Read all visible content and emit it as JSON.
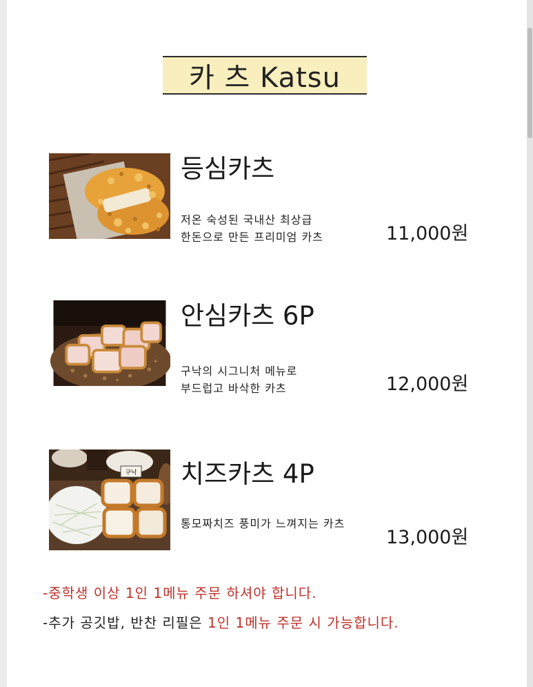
{
  "title": "카 츠 Katsu",
  "colors": {
    "title_background": "#f9efbe",
    "notice_red": "#c0302a",
    "text": "#222222"
  },
  "items": [
    {
      "name": "등심카츠",
      "desc": [
        "저온 숙성된 국내산 최상급",
        "한돈으로 만든 프리미엄 카츠"
      ],
      "price": "11,000원"
    },
    {
      "name": "안심카츠 6P",
      "desc": [
        "구낙의 시그니처 메뉴로",
        "부드럽고 바삭한 카츠"
      ],
      "price": "12,000원"
    },
    {
      "name": "치즈카츠 4P",
      "desc": [
        "통모짜치즈 풍미가 느껴지는 카츠"
      ],
      "price": "13,000원"
    }
  ],
  "photo_label": "구낙",
  "notices": {
    "line1": "-중학생 이상 1인 1메뉴 주문 하셔야 합니다.",
    "line2_prefix": "-추가 공깃밥, 반찬 리필은 ",
    "line2_highlight": "1인 1메뉴 주문 시 가능합니다."
  }
}
